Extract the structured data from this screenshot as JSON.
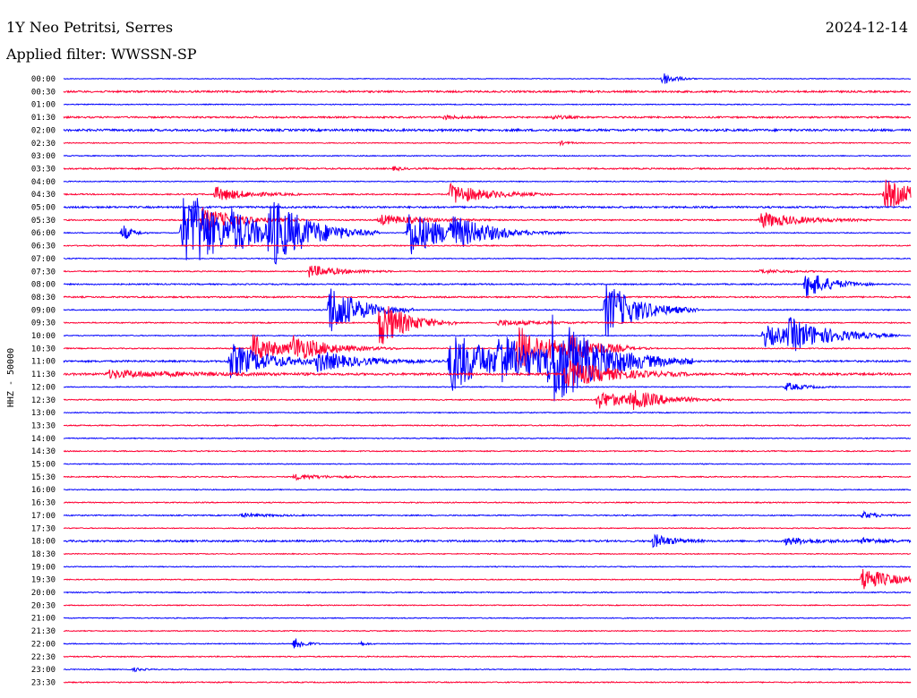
{
  "header": {
    "station": "1Y Neo Petritsi, Serres",
    "date": "2024-12-14",
    "filter_label": "Applied filter: WWSSN-SP"
  },
  "chart_data": {
    "type": "line",
    "channel_label": "HHZ - 50000",
    "colors": {
      "even_hour": "#0000ff",
      "odd_half": "#ff0033"
    },
    "x_range_minutes": [
      0,
      30
    ],
    "rows": [
      {
        "label": "00:00",
        "color": "#0000ff",
        "noise": 0.4,
        "events": [
          {
            "t": 21.2,
            "a": 8,
            "d": 0.4
          }
        ]
      },
      {
        "label": "00:30",
        "color": "#ff0033",
        "noise": 1.0,
        "events": []
      },
      {
        "label": "01:00",
        "color": "#0000ff",
        "noise": 0.5,
        "events": []
      },
      {
        "label": "01:30",
        "color": "#ff0033",
        "noise": 0.9,
        "events": [
          {
            "t": 13.5,
            "a": 2,
            "d": 0.5
          },
          {
            "t": 17.3,
            "a": 2,
            "d": 0.5
          }
        ]
      },
      {
        "label": "02:00",
        "color": "#0000ff",
        "noise": 1.2,
        "events": []
      },
      {
        "label": "02:30",
        "color": "#ff0033",
        "noise": 0.5,
        "events": [
          {
            "t": 17.6,
            "a": 2,
            "d": 0.3
          }
        ]
      },
      {
        "label": "03:00",
        "color": "#0000ff",
        "noise": 0.5,
        "events": []
      },
      {
        "label": "03:30",
        "color": "#ff0033",
        "noise": 0.8,
        "events": [
          {
            "t": 11.7,
            "a": 2,
            "d": 0.3
          }
        ]
      },
      {
        "label": "04:00",
        "color": "#0000ff",
        "noise": 0.5,
        "events": []
      },
      {
        "label": "04:30",
        "color": "#ff0033",
        "noise": 0.7,
        "events": [
          {
            "t": 5.4,
            "a": 8,
            "d": 1.0
          },
          {
            "t": 13.7,
            "a": 12,
            "d": 1.2
          },
          {
            "t": 29.1,
            "a": 16,
            "d": 1.3
          }
        ]
      },
      {
        "label": "05:00",
        "color": "#0000ff",
        "noise": 1.0,
        "events": []
      },
      {
        "label": "05:30",
        "color": "#ff0033",
        "noise": 0.7,
        "events": [
          {
            "t": 4.9,
            "a": 14,
            "d": 1.2
          },
          {
            "t": 11.2,
            "a": 6,
            "d": 1.3
          },
          {
            "t": 24.7,
            "a": 9,
            "d": 1.3
          }
        ]
      },
      {
        "label": "06:00",
        "color": "#0000ff",
        "noise": 0.5,
        "events": [
          {
            "t": 2.1,
            "a": 10,
            "d": 0.3
          },
          {
            "t": 4.2,
            "a": 40,
            "d": 1.0
          },
          {
            "t": 4.6,
            "a": 20,
            "d": 1.0
          },
          {
            "t": 5.9,
            "a": 16,
            "d": 1.4
          },
          {
            "t": 7.3,
            "a": 36,
            "d": 1.3
          },
          {
            "t": 12.2,
            "a": 28,
            "d": 1.2
          },
          {
            "t": 13.7,
            "a": 14,
            "d": 1.4
          }
        ]
      },
      {
        "label": "06:30",
        "color": "#ff0033",
        "noise": 0.6,
        "events": []
      },
      {
        "label": "07:00",
        "color": "#0000ff",
        "noise": 0.5,
        "events": []
      },
      {
        "label": "07:30",
        "color": "#ff0033",
        "noise": 0.6,
        "events": [
          {
            "t": 8.7,
            "a": 7,
            "d": 1.0
          },
          {
            "t": 24.7,
            "a": 2,
            "d": 1.0
          }
        ]
      },
      {
        "label": "08:00",
        "color": "#0000ff",
        "noise": 0.7,
        "events": [
          {
            "t": 26.3,
            "a": 16,
            "d": 0.8
          }
        ]
      },
      {
        "label": "08:30",
        "color": "#ff0033",
        "noise": 0.8,
        "events": []
      },
      {
        "label": "09:00",
        "color": "#0000ff",
        "noise": 0.6,
        "events": [
          {
            "t": 9.4,
            "a": 30,
            "d": 1.0
          },
          {
            "t": 19.2,
            "a": 32,
            "d": 1.1
          }
        ]
      },
      {
        "label": "09:30",
        "color": "#ff0033",
        "noise": 0.6,
        "events": [
          {
            "t": 11.2,
            "a": 28,
            "d": 0.9
          },
          {
            "t": 15.4,
            "a": 3,
            "d": 1.5
          }
        ]
      },
      {
        "label": "10:00",
        "color": "#0000ff",
        "noise": 0.5,
        "events": [
          {
            "t": 24.8,
            "a": 12,
            "d": 1.5
          },
          {
            "t": 25.7,
            "a": 14,
            "d": 1.3
          }
        ]
      },
      {
        "label": "10:30",
        "color": "#ff0033",
        "noise": 0.6,
        "events": [
          {
            "t": 6.7,
            "a": 16,
            "d": 1.0
          },
          {
            "t": 8.1,
            "a": 12,
            "d": 1.3
          },
          {
            "t": 16.1,
            "a": 26,
            "d": 1.3
          },
          {
            "t": 17.9,
            "a": 10,
            "d": 1.0
          }
        ]
      },
      {
        "label": "11:00",
        "color": "#0000ff",
        "noise": 1.0,
        "events": [
          {
            "t": 5.9,
            "a": 20,
            "d": 1.3
          },
          {
            "t": 9.0,
            "a": 10,
            "d": 1.5
          },
          {
            "t": 13.7,
            "a": 36,
            "d": 1.5
          },
          {
            "t": 15.4,
            "a": 22,
            "d": 1.5
          },
          {
            "t": 17.2,
            "a": 48,
            "d": 1.7
          }
        ]
      },
      {
        "label": "11:30",
        "color": "#ff0033",
        "noise": 1.2,
        "events": [
          {
            "t": 1.6,
            "a": 4,
            "d": 2.5
          },
          {
            "t": 17.8,
            "a": 16,
            "d": 1.5
          }
        ]
      },
      {
        "label": "12:00",
        "color": "#0000ff",
        "noise": 0.5,
        "events": [
          {
            "t": 25.6,
            "a": 5,
            "d": 0.6
          }
        ]
      },
      {
        "label": "12:30",
        "color": "#ff0033",
        "noise": 0.6,
        "events": [
          {
            "t": 18.9,
            "a": 10,
            "d": 1.2
          },
          {
            "t": 20.1,
            "a": 8,
            "d": 1.2
          }
        ]
      },
      {
        "label": "13:00",
        "color": "#0000ff",
        "noise": 0.5,
        "events": []
      },
      {
        "label": "13:30",
        "color": "#ff0033",
        "noise": 0.6,
        "events": []
      },
      {
        "label": "14:00",
        "color": "#0000ff",
        "noise": 0.5,
        "events": []
      },
      {
        "label": "14:30",
        "color": "#ff0033",
        "noise": 0.6,
        "events": []
      },
      {
        "label": "15:00",
        "color": "#0000ff",
        "noise": 0.5,
        "events": []
      },
      {
        "label": "15:30",
        "color": "#ff0033",
        "noise": 0.6,
        "events": [
          {
            "t": 8.2,
            "a": 3,
            "d": 1.0
          }
        ]
      },
      {
        "label": "16:00",
        "color": "#0000ff",
        "noise": 0.5,
        "events": []
      },
      {
        "label": "16:30",
        "color": "#ff0033",
        "noise": 0.6,
        "events": []
      },
      {
        "label": "17:00",
        "color": "#0000ff",
        "noise": 0.6,
        "events": [
          {
            "t": 6.3,
            "a": 2,
            "d": 1.0
          },
          {
            "t": 28.3,
            "a": 4,
            "d": 0.5
          }
        ]
      },
      {
        "label": "17:30",
        "color": "#ff0033",
        "noise": 0.5,
        "events": []
      },
      {
        "label": "18:00",
        "color": "#0000ff",
        "noise": 1.0,
        "events": [
          {
            "t": 20.9,
            "a": 8,
            "d": 0.6
          },
          {
            "t": 25.6,
            "a": 4,
            "d": 1.0
          },
          {
            "t": 28.3,
            "a": 3,
            "d": 0.8
          }
        ]
      },
      {
        "label": "18:30",
        "color": "#ff0033",
        "noise": 0.5,
        "events": []
      },
      {
        "label": "19:00",
        "color": "#0000ff",
        "noise": 0.5,
        "events": []
      },
      {
        "label": "19:30",
        "color": "#ff0033",
        "noise": 0.5,
        "events": [
          {
            "t": 28.3,
            "a": 14,
            "d": 1.0
          }
        ]
      },
      {
        "label": "20:00",
        "color": "#0000ff",
        "noise": 0.6,
        "events": []
      },
      {
        "label": "20:30",
        "color": "#ff0033",
        "noise": 0.5,
        "events": []
      },
      {
        "label": "21:00",
        "color": "#0000ff",
        "noise": 0.5,
        "events": []
      },
      {
        "label": "21:30",
        "color": "#ff0033",
        "noise": 0.5,
        "events": []
      },
      {
        "label": "22:00",
        "color": "#0000ff",
        "noise": 0.5,
        "events": [
          {
            "t": 8.2,
            "a": 8,
            "d": 0.3
          },
          {
            "t": 10.5,
            "a": 3,
            "d": 0.2
          }
        ]
      },
      {
        "label": "22:30",
        "color": "#ff0033",
        "noise": 0.6,
        "events": []
      },
      {
        "label": "23:00",
        "color": "#0000ff",
        "noise": 0.5,
        "events": [
          {
            "t": 2.5,
            "a": 2,
            "d": 0.3
          }
        ]
      },
      {
        "label": "23:30",
        "color": "#ff0033",
        "noise": 0.6,
        "events": []
      }
    ]
  }
}
